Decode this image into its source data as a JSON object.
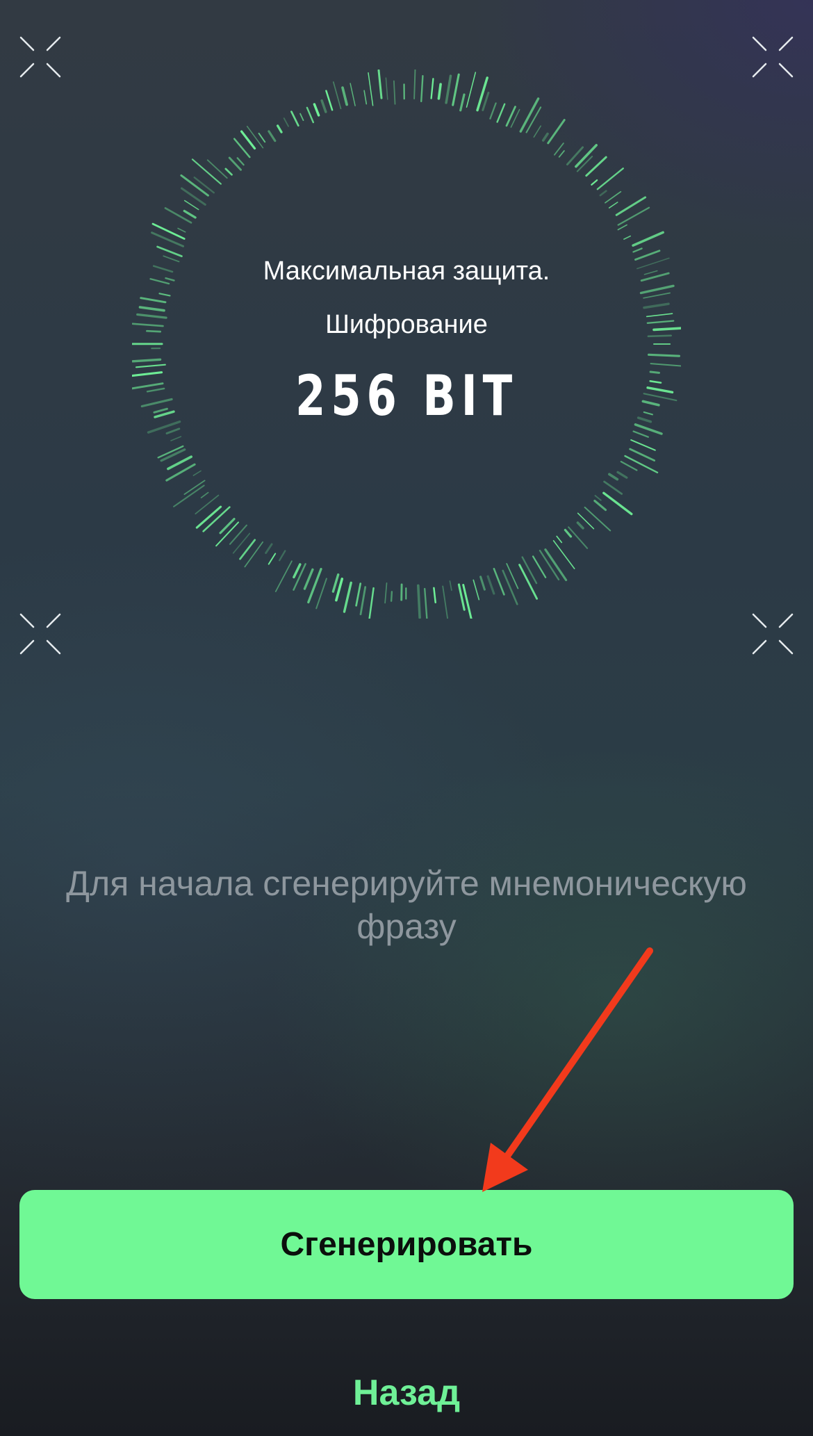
{
  "security": {
    "line1": "Максимальная защита.",
    "line2": "Шифрование",
    "strength": "256 BIT"
  },
  "prompt": {
    "text": "Для начала сгенерируйте мнемоническую фразу"
  },
  "actions": {
    "generate_label": "Сгенерировать",
    "back_label": "Назад"
  },
  "icons": {
    "corners": "focus-corner-icon",
    "ring": "sound-wave-ring",
    "annotation": "red-arrow-annotation"
  },
  "colors": {
    "accent_green": "#70f895",
    "back_text_green": "#6ff097",
    "hint_gray": "#8e979e",
    "arrow_red": "#f23a1c"
  }
}
